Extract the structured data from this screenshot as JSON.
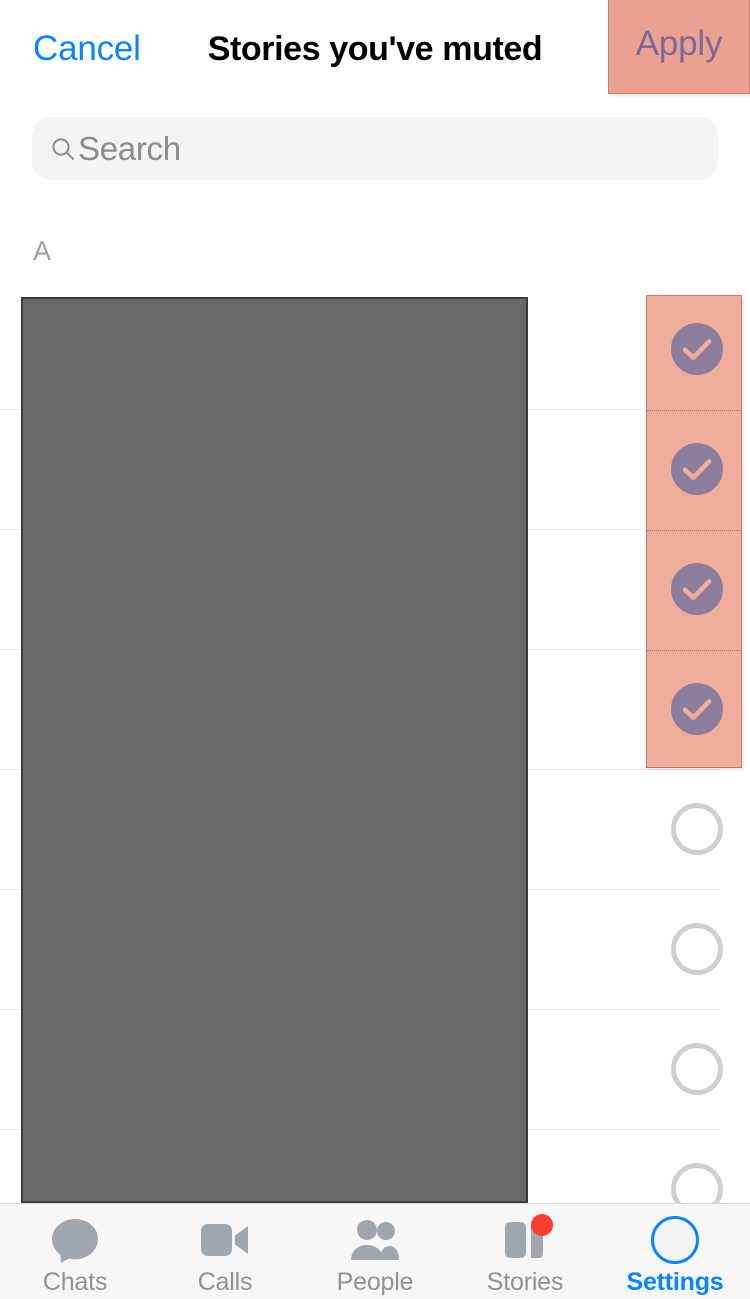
{
  "header": {
    "cancel_label": "Cancel",
    "title": "Stories you've muted",
    "apply_label": "Apply",
    "cancel_color": "#0b84ff",
    "apply_highlight_color": "#eba18f"
  },
  "search": {
    "placeholder": "Search",
    "value": "",
    "icon": "search-icon"
  },
  "section": {
    "letter": "A"
  },
  "list": {
    "rows": [
      {
        "name": "",
        "selected": true
      },
      {
        "name": "",
        "selected": true
      },
      {
        "name": "",
        "selected": true
      },
      {
        "name": "",
        "selected": true
      },
      {
        "name": "",
        "selected": false
      },
      {
        "name": "",
        "selected": false
      },
      {
        "name": "",
        "selected": false
      },
      {
        "name": "",
        "selected": false
      }
    ],
    "selected_count": 4,
    "selected_color": "#0b84ff",
    "unselected_color": "#cfcfd3"
  },
  "highlight": {
    "selection_overlay_color": "#e4785a",
    "apply_overlay_color": "#eba18f"
  },
  "tabbar": {
    "tabs": [
      {
        "label": "Chats",
        "icon": "chat-bubble-icon",
        "active": false,
        "badge": false
      },
      {
        "label": "Calls",
        "icon": "video-camera-icon",
        "active": false,
        "badge": false
      },
      {
        "label": "People",
        "icon": "people-icon",
        "active": false,
        "badge": false
      },
      {
        "label": "Stories",
        "icon": "stories-icon",
        "active": true,
        "badge": true
      },
      {
        "label": "Settings",
        "icon": "avatar-icon",
        "active": false,
        "badge": false
      }
    ],
    "active_label": "Settings",
    "active_color": "#0b84ff",
    "inactive_color": "#8e9297",
    "badge_color": "#fa3e30"
  }
}
